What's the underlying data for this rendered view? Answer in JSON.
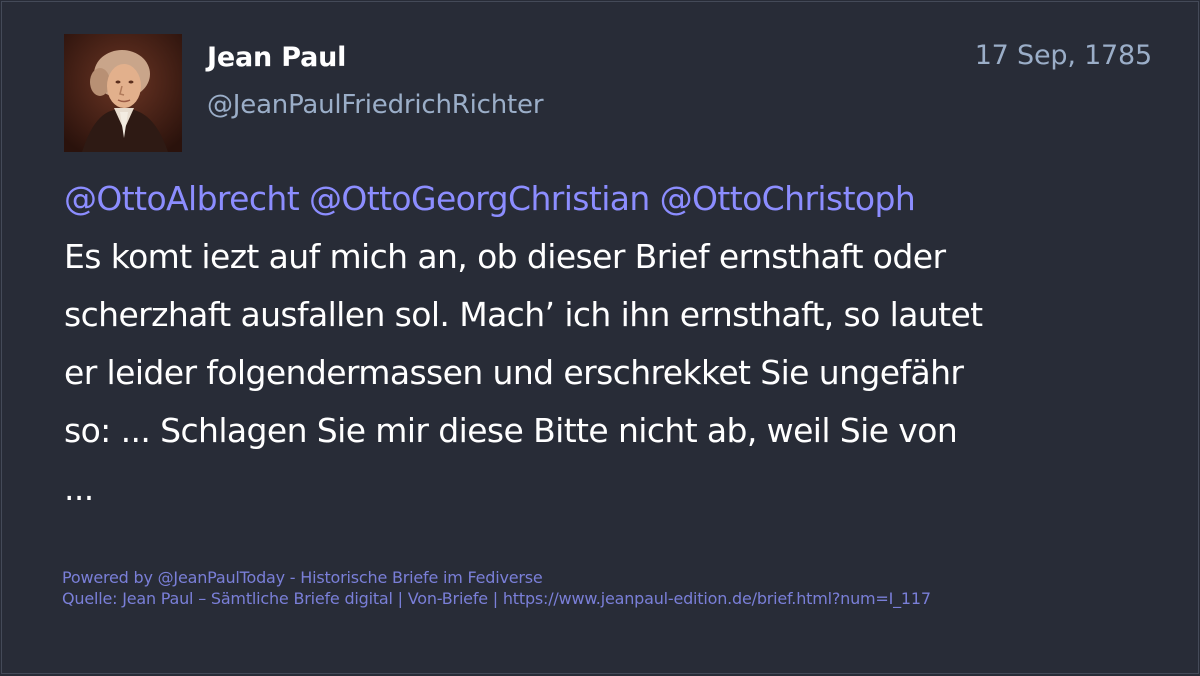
{
  "post": {
    "author_name": "Jean Paul",
    "author_handle": "@JeanPaulFriedrichRichter",
    "date": "17 Sep, 1785",
    "mentions": [
      "@OttoAlbrecht",
      "@OttoGeorgChristian",
      "@OttoChristoph"
    ],
    "lines": [
      "Es komt iezt auf mich an, ob dieser Brief ernsthaft oder",
      "scherzhaft ausfallen sol. Mach’ ich ihn ernsthaft, so lautet",
      "er leider folgendermassen und erschrekket Sie ungefähr",
      "so: ... Schlagen Sie mir diese Bitte nicht ab, weil Sie von",
      "..."
    ]
  },
  "footer": {
    "powered_by": "Powered by @JeanPaulToday - Historische Briefe im Fediverse",
    "source": "Quelle: Jean Paul – Sämtliche Briefe digital | Von-Briefe | https://www.jeanpaul-edition.de/brief.html?num=I_117"
  },
  "colors": {
    "background": "#282c37",
    "text": "#ffffff",
    "secondary": "#9baec8",
    "mention": "#8c8dff",
    "footer": "#7a7fd8"
  },
  "icons": {
    "avatar": "portrait-avatar-icon"
  }
}
